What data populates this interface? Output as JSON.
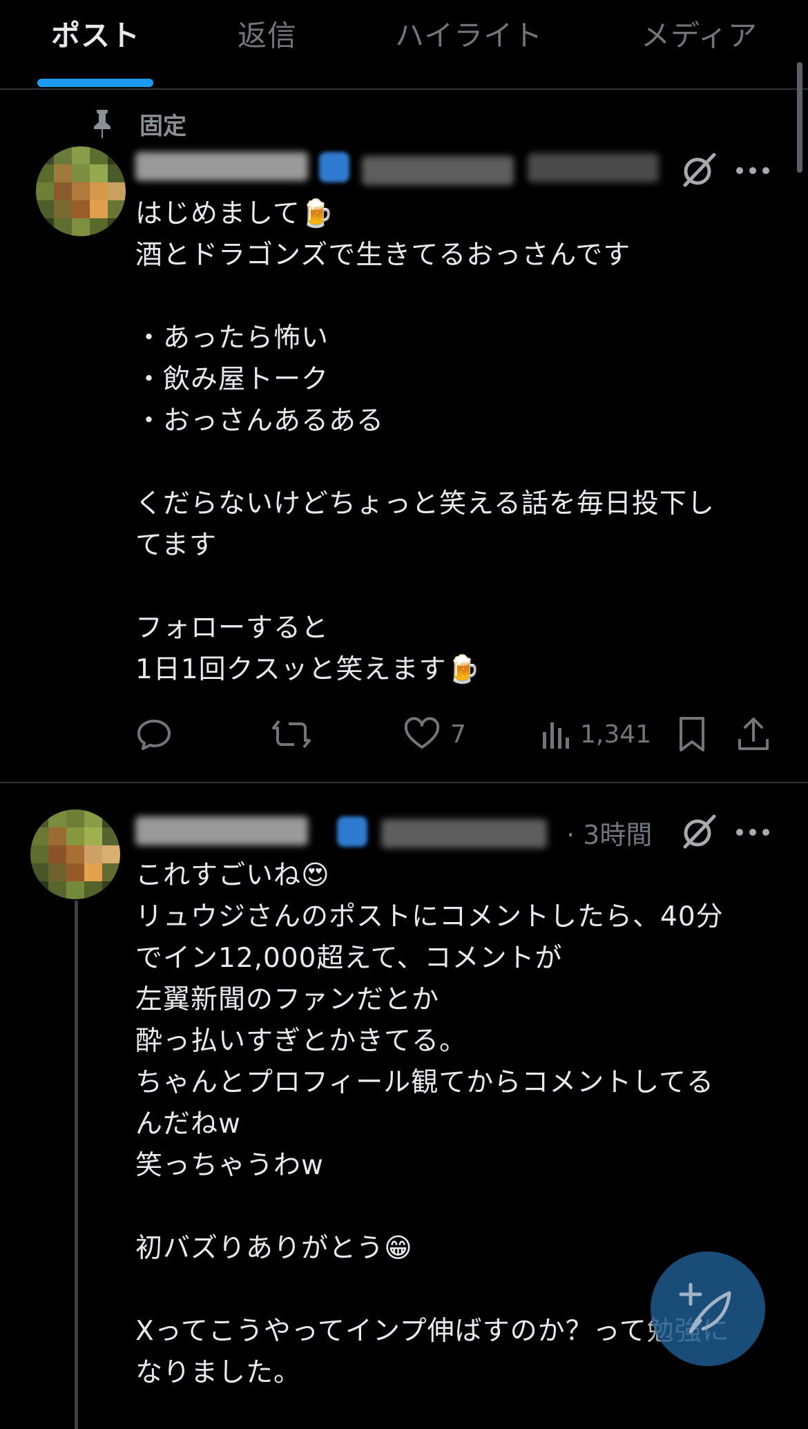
{
  "tabs": [
    {
      "label": "ポスト",
      "active": true
    },
    {
      "label": "返信",
      "active": false
    },
    {
      "label": "ハイライト",
      "active": false
    },
    {
      "label": "メディア",
      "active": false
    }
  ],
  "colors": {
    "accent": "#1d9bf0",
    "background": "#000000",
    "text": "#e7e9ea",
    "muted": "#71767b",
    "divider": "#2f3336"
  },
  "posts": [
    {
      "pinned_label": "固定",
      "author_name_hidden": true,
      "body": "はじめまして🍺\n酒とドラゴンズで生きてるおっさんです\n\n・あったら怖い\n・飲み屋トーク\n・おっさんあるある\n\nくだらないけどちょっと笑える話を毎日投下し\nてます\n\nフォローすると\n1日1回クスッと笑えます🍺",
      "likes": "7",
      "views": "1,341",
      "icons": [
        "pin-icon",
        "grok-icon",
        "more-icon",
        "reply-icon",
        "repost-icon",
        "like-icon",
        "views-icon",
        "bookmark-icon",
        "share-icon"
      ]
    },
    {
      "time": "· 3時間",
      "body": "これすごいね😍\nリュウジさんのポストにコメントしたら、40分\nでイン12,000超えて、コメントが\n左翼新聞のファンだとか\n酔っ払いすぎとかきてる。\nちゃんとプロフィール観てからコメントしてる\nんだねw\n笑っちゃうわw\n\n初バズりありがとう😁\n\nXってこうやってインプ伸ばすのか？って勉強に\nなりました。"
    }
  ],
  "fab": {
    "icon": "compose-post-icon"
  }
}
